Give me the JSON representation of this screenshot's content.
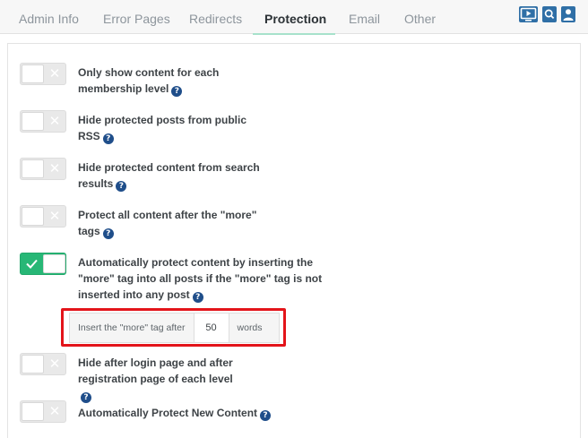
{
  "tabs": [
    {
      "label": "Admin Info"
    },
    {
      "label": "Error Pages"
    },
    {
      "label": "Redirects"
    },
    {
      "label": "Protection"
    },
    {
      "label": "Email"
    },
    {
      "label": "Other"
    }
  ],
  "active_tab": "Protection",
  "top_icons": [
    "video-icon",
    "search-icon",
    "user-icon"
  ],
  "colors": {
    "toggle_on": "#27b776",
    "toggle_off": "#e9e9e9",
    "help_icon": "#1f4e8a",
    "highlight_border": "#e3141a",
    "active_tab_underline": "#a7e2cb"
  },
  "settings": [
    {
      "label": "Only show content for each membership level",
      "enabled": false
    },
    {
      "label": "Hide protected posts from public RSS",
      "enabled": false
    },
    {
      "label": "Hide protected content from search results",
      "enabled": false
    },
    {
      "label": "Protect all content after the \"more\" tags",
      "enabled": false
    },
    {
      "label": "Automatically protect content by inserting the \"more\" tag into all posts if the \"more\" tag is not inserted into any post",
      "enabled": true
    },
    {
      "label": "Hide after login page and after registration page of each level",
      "enabled": false
    },
    {
      "label": "Automatically Protect New Content",
      "enabled": false
    }
  ],
  "more_tag": {
    "prefix": "Insert the \"more\" tag after",
    "value": "50",
    "suffix": "words"
  },
  "help_glyph": "?",
  "toggle_off_glyph": "✕"
}
